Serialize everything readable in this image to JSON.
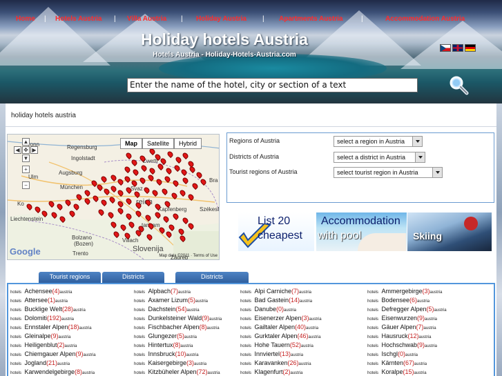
{
  "nav": [
    {
      "label": "Home"
    },
    {
      "label": "Hotels Austria"
    },
    {
      "label": "Villa Austria"
    },
    {
      "label": "Holiday Austria"
    },
    {
      "label": "Apartments Austria"
    },
    {
      "label": "Accommodation Austria"
    }
  ],
  "nav_separator": "|",
  "header": {
    "title": "Holiday hotels Austria",
    "subtitle": "Hotels Austria - Holiday-Hotels-Austria.com"
  },
  "languages": [
    "cz",
    "en",
    "de"
  ],
  "search": {
    "value": "Enter the name of the hotel, city or section of a text",
    "icon": "magnifier-icon"
  },
  "breadcrumb": "holiday hotels austria",
  "map": {
    "type_buttons": [
      "Map",
      "Satellite",
      "Hybrid"
    ],
    "active_type": "Map",
    "labels": {
      "regensburg": "Regensburg",
      "ingolstadt": "Ingolstadt",
      "augsburg": "Augsburg",
      "munchen": "München",
      "ulm": "Ulm",
      "zwettl": "Zwettl",
      "bratislava": "Bra",
      "szekesfehervar": "Székesfe",
      "bolzano": "Bolzano",
      "bozen": "(Bozen)",
      "trento": "Trento",
      "villach": "Villach",
      "slovenija": "Slovenija",
      "zagreb": "Zagreb",
      "liechtenstein": "Liechtenstein",
      "ronn": "ronn",
      "reich": "reich",
      "kapfenberg": "Kapfenberg",
      "laam": "tam am",
      "bra": "Bra",
      "svaz": "Svaz",
      "ko": "Ko"
    },
    "logo": "Google",
    "copyright": "Map data ©2011 · Terms of Use"
  },
  "selectors": [
    {
      "label": "Regions of Austria",
      "value": "select a region in Austria"
    },
    {
      "label": "Districts of Austria",
      "value": "select a district in Austria"
    },
    {
      "label": "Tourist regions of Austria",
      "value": "select tourist region in Austria"
    }
  ],
  "banners": {
    "cheapest": [
      "List 20",
      "cheapest"
    ],
    "pool": [
      "Accommodation",
      "with pool"
    ],
    "skiing": "Skiing"
  },
  "tabs": [
    "Tourist regions",
    "Districts",
    "Districts"
  ],
  "list_prefix": "hotels",
  "list_suffix": "austria",
  "columns": [
    [
      {
        "name": "Achensee",
        "count": "(4)"
      },
      {
        "name": "Attersee",
        "count": "(1)"
      },
      {
        "name": "Bucklige Welt",
        "count": "(28)"
      },
      {
        "name": "Dolomiti",
        "count": "(192)"
      },
      {
        "name": "Ennstaler Alpen",
        "count": "(18)"
      },
      {
        "name": "Gleinalpe",
        "count": "(9)"
      },
      {
        "name": "Heiligenblut",
        "count": "(2)"
      },
      {
        "name": "Chiemgauer Alpen",
        "count": "(9)"
      },
      {
        "name": "Jogland",
        "count": "(21)"
      },
      {
        "name": "Karwendelgebirge",
        "count": "(8)"
      }
    ],
    [
      {
        "name": "Alpbach",
        "count": "(7)"
      },
      {
        "name": "Axamer Lizum",
        "count": "(5)"
      },
      {
        "name": "Dachstein",
        "count": "(54)"
      },
      {
        "name": "Dunkelsteiner Wald",
        "count": "(9)"
      },
      {
        "name": "Fischbacher Alpen",
        "count": "(8)"
      },
      {
        "name": "Glungezer",
        "count": "(5)"
      },
      {
        "name": "Hintertux",
        "count": "(8)"
      },
      {
        "name": "Innsbruck",
        "count": "(10)"
      },
      {
        "name": "Kaisergebirge",
        "count": "(3)"
      },
      {
        "name": "Kitzbüheler Alpen",
        "count": "(72)"
      }
    ],
    [
      {
        "name": "Alpi Carniche",
        "count": "(7)"
      },
      {
        "name": "Bad Gastein",
        "count": "(14)"
      },
      {
        "name": "Danube",
        "count": "(0)"
      },
      {
        "name": "Eisenerzer Alpen",
        "count": "(3)"
      },
      {
        "name": "Gailtaler Alpen",
        "count": "(40)"
      },
      {
        "name": "Gurktaler Alpen",
        "count": "(46)"
      },
      {
        "name": "Hohe Tauern",
        "count": "(52)"
      },
      {
        "name": "Innviertel",
        "count": "(13)"
      },
      {
        "name": "Karavanken",
        "count": "(26)"
      },
      {
        "name": "Klagenfurt",
        "count": "(2)"
      }
    ],
    [
      {
        "name": "Ammergebirge",
        "count": "(3)"
      },
      {
        "name": "Bodensee",
        "count": "(6)"
      },
      {
        "name": "Defregger Alpen",
        "count": "(5)"
      },
      {
        "name": "Eisenwurzen",
        "count": "(9)"
      },
      {
        "name": "Gäuer Alpen",
        "count": "(7)"
      },
      {
        "name": "Hausruck",
        "count": "(12)"
      },
      {
        "name": "Hochschwab",
        "count": "(9)"
      },
      {
        "name": "Ischgl",
        "count": "(0)"
      },
      {
        "name": "Kärnten",
        "count": "(67)"
      },
      {
        "name": "Koralpe",
        "count": "(15)"
      }
    ]
  ]
}
